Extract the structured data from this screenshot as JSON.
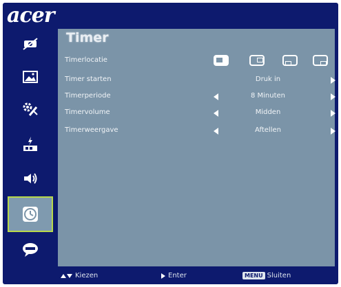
{
  "brand": {
    "logo_text": "acer"
  },
  "sidebar": {
    "items": [
      {
        "name": "picture-off-icon",
        "active": false
      },
      {
        "name": "image-icon",
        "active": false
      },
      {
        "name": "settings-icon",
        "active": false
      },
      {
        "name": "management-icon",
        "active": false
      },
      {
        "name": "audio-icon",
        "active": false
      },
      {
        "name": "timer-icon",
        "active": true
      },
      {
        "name": "language-icon",
        "active": false
      }
    ]
  },
  "panel": {
    "title": "Timer",
    "rows": [
      {
        "label": "Timerlocatie",
        "type": "location"
      },
      {
        "label": "Timer starten",
        "value": "Druk in"
      },
      {
        "label": "Timerperiode",
        "value": "8 Minuten"
      },
      {
        "label": "Timervolume",
        "value": "Midden"
      },
      {
        "label": "Timerweergave",
        "value": "Aftellen"
      }
    ]
  },
  "footer": {
    "select_label": "Kiezen",
    "enter_label": "Enter",
    "menu_key": "MENU",
    "close_label": "Sluiten"
  },
  "colors": {
    "osd_background": "#0d1a6e",
    "panel_background": "#7b94a8",
    "active_highlight_border": "#b8d84a"
  }
}
